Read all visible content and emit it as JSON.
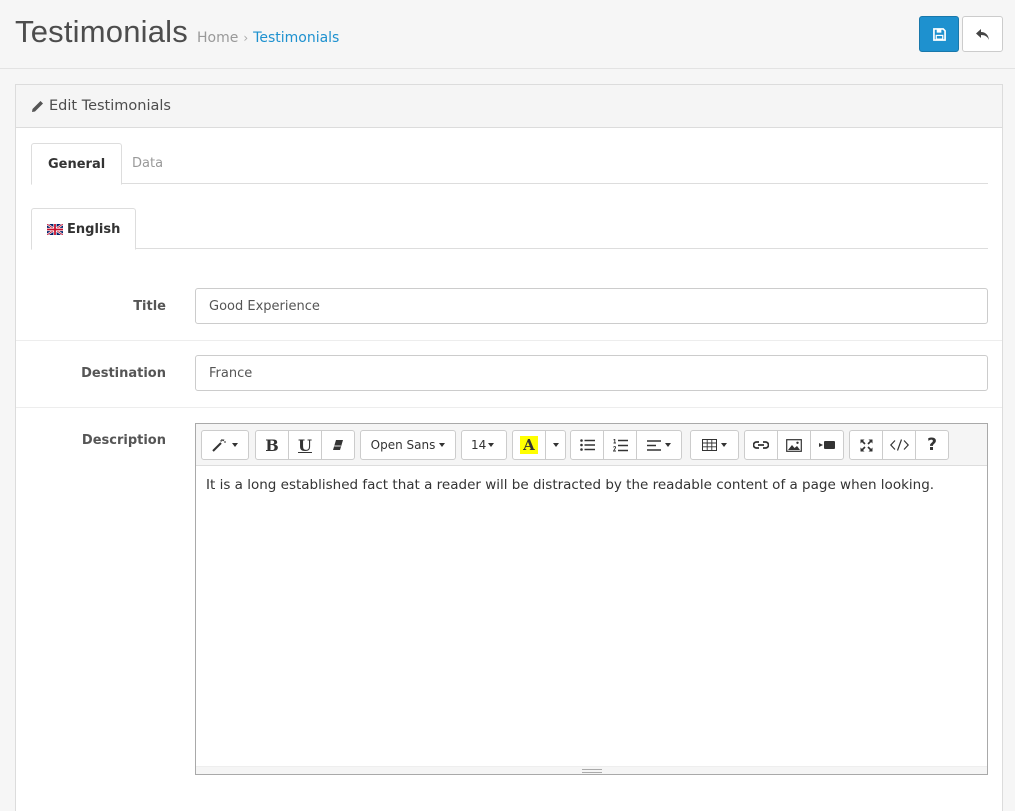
{
  "header": {
    "title": "Testimonials",
    "breadcrumb": {
      "home": "Home",
      "separator": "›",
      "current": "Testimonials"
    }
  },
  "actions": {
    "save_icon": "floppy-disk-icon",
    "back_icon": "reply-arrow-icon"
  },
  "panel": {
    "title": "Edit Testimonials",
    "title_icon": "pencil-icon"
  },
  "tabs": [
    {
      "label": "General",
      "active": true
    },
    {
      "label": "Data",
      "active": false
    }
  ],
  "language_tab": {
    "label": "English",
    "flag": "uk-flag-icon"
  },
  "form": {
    "title": {
      "label": "Title",
      "value": "Good Experience"
    },
    "destination": {
      "label": "Destination",
      "value": "France"
    },
    "description": {
      "label": "Description",
      "value": "It is a long established fact that a reader will be distracted by the readable content of a page when looking."
    }
  },
  "editor_toolbar": {
    "font_name": "Open Sans",
    "font_size": "14",
    "text_color_letter": "A",
    "highlight_color": "#ffff00"
  },
  "colors": {
    "primary": "#1e91cf",
    "link": "#1e91cf"
  }
}
